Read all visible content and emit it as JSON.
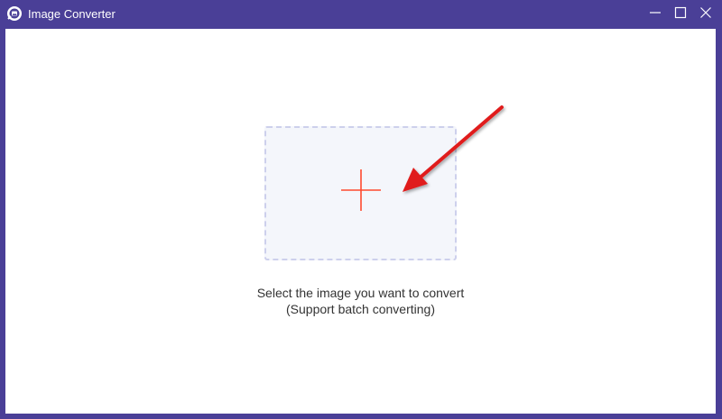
{
  "window": {
    "title": "Image Converter"
  },
  "icons": {
    "app": "image-converter-logo-icon",
    "minimize": "minimize-icon",
    "maximize": "maximize-icon",
    "close": "close-icon",
    "add": "plus-icon",
    "annotation": "red-arrow-icon"
  },
  "dropzone": {
    "instruction": "Select the image you want to convert",
    "note": "(Support batch converting)"
  },
  "colors": {
    "titlebar": "#4a3f97",
    "accent": "#ff4a2e",
    "dropzone_bg": "#f4f6fb",
    "dropzone_border": "#cdd0ec",
    "annotation_arrow": "#e01a1a"
  }
}
